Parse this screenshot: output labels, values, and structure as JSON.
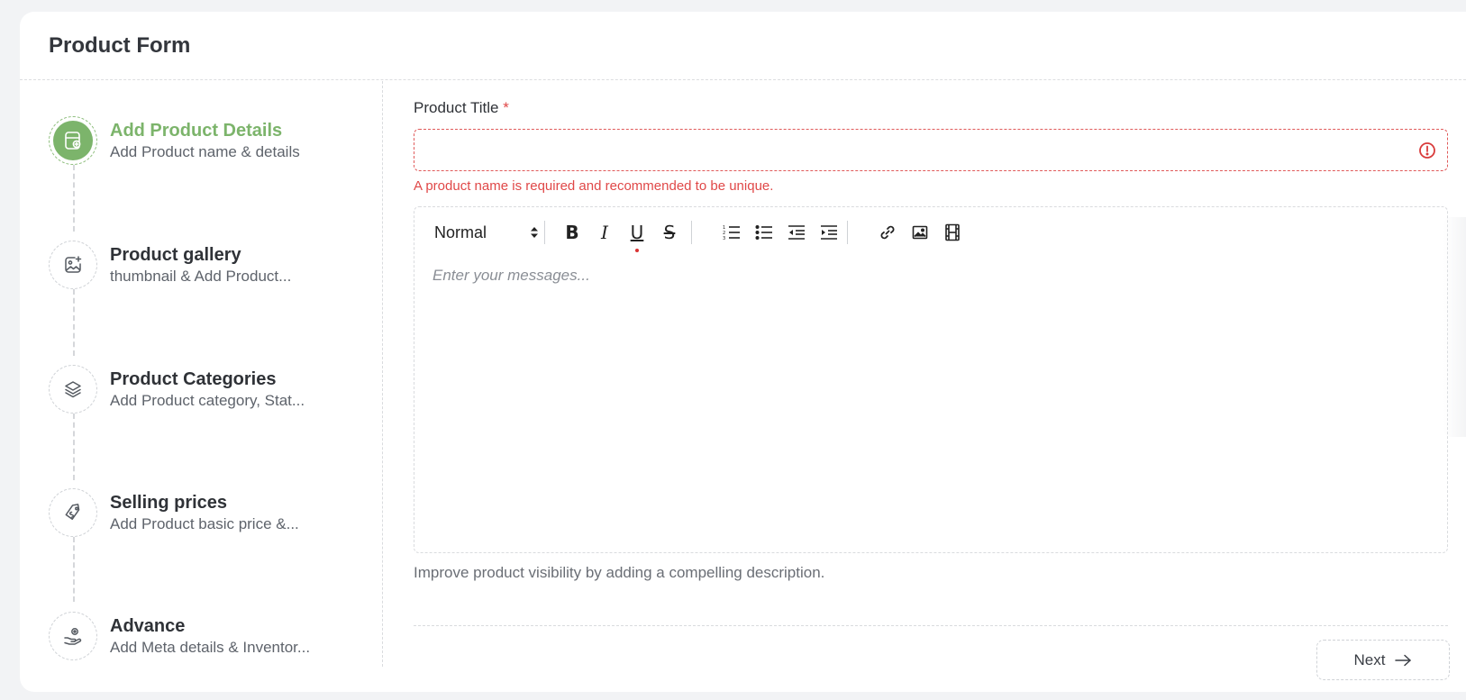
{
  "header": {
    "title": "Product Form"
  },
  "steps": [
    {
      "title": "Add Product Details",
      "subtitle": "Add Product name & details",
      "icon": "package-add-icon",
      "active": true
    },
    {
      "title": "Product gallery",
      "subtitle": "thumbnail & Add Product...",
      "icon": "gallery-add-icon",
      "active": false
    },
    {
      "title": "Product Categories",
      "subtitle": "Add Product category, Stat...",
      "icon": "layers-icon",
      "active": false
    },
    {
      "title": "Selling prices",
      "subtitle": "Add Product basic price &...",
      "icon": "price-tag-icon",
      "active": false
    },
    {
      "title": "Advance",
      "subtitle": "Add Meta details & Inventor...",
      "icon": "hand-settings-icon",
      "active": false
    }
  ],
  "form": {
    "title_label": "Product Title",
    "required_mark": "*",
    "title_value": "",
    "title_error": "A product name is required and recommended to be unique.",
    "editor": {
      "format_value": "Normal",
      "tools": [
        "B",
        "I",
        "U",
        "S"
      ],
      "placeholder": "Enter your messages..."
    },
    "helper": "Improve product visibility by adding a compelling description.",
    "next_label": "Next"
  },
  "colors": {
    "accent": "#7cb46b",
    "error": "#e04848"
  }
}
